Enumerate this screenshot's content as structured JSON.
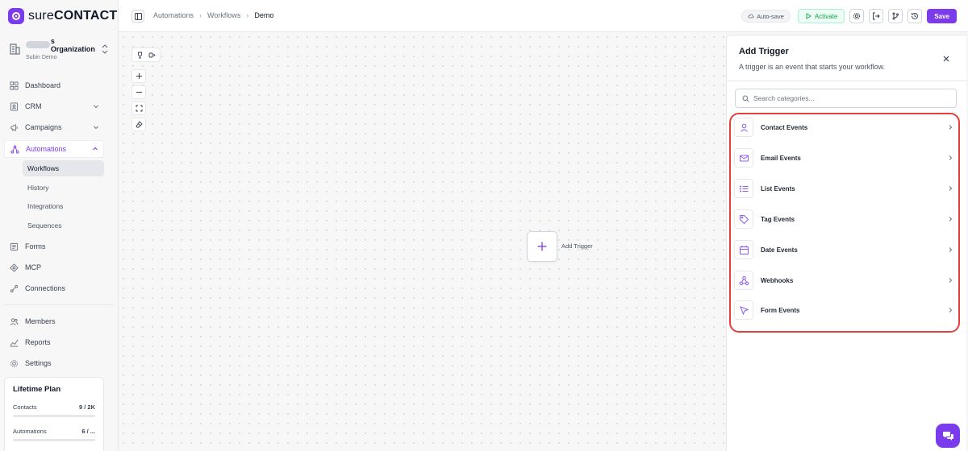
{
  "brand": {
    "name_sure": "sure",
    "name_contact": "CONTACT",
    "accent": "#7c3aed"
  },
  "org": {
    "name_suffix": "s Organization",
    "user": "Subin Demo"
  },
  "nav": {
    "dashboard": "Dashboard",
    "crm": "CRM",
    "campaigns": "Campaigns",
    "automations": "Automations",
    "sub": {
      "workflows": "Workflows",
      "history": "History",
      "integrations": "Integrations",
      "sequences": "Sequences"
    },
    "forms": "Forms",
    "mcp": "MCP",
    "connections": "Connections",
    "members": "Members",
    "reports": "Reports",
    "settings": "Settings"
  },
  "plan": {
    "title": "Lifetime Plan",
    "contacts_label": "Contacts",
    "contacts_value": "9 / 2K",
    "automations_label": "Automations",
    "automations_value": "6 / ..."
  },
  "breadcrumb": {
    "items": [
      "Automations",
      "Workflows",
      "Demo"
    ]
  },
  "toolbar": {
    "autosave": "Auto-save",
    "activate": "Activate",
    "save": "Save"
  },
  "canvas": {
    "add_trigger_label": "Add Trigger"
  },
  "trigger_panel": {
    "title": "Add Trigger",
    "subtitle": "A trigger is an event that starts your workflow.",
    "search_placeholder": "Search categories...",
    "categories": [
      {
        "label": "Contact Events",
        "icon": "user-icon"
      },
      {
        "label": "Email Events",
        "icon": "mail-icon"
      },
      {
        "label": "List Events",
        "icon": "list-icon"
      },
      {
        "label": "Tag Events",
        "icon": "tag-icon"
      },
      {
        "label": "Date Events",
        "icon": "calendar-icon"
      },
      {
        "label": "Webhooks",
        "icon": "webhook-icon"
      },
      {
        "label": "Form Events",
        "icon": "cursor-icon"
      }
    ]
  }
}
